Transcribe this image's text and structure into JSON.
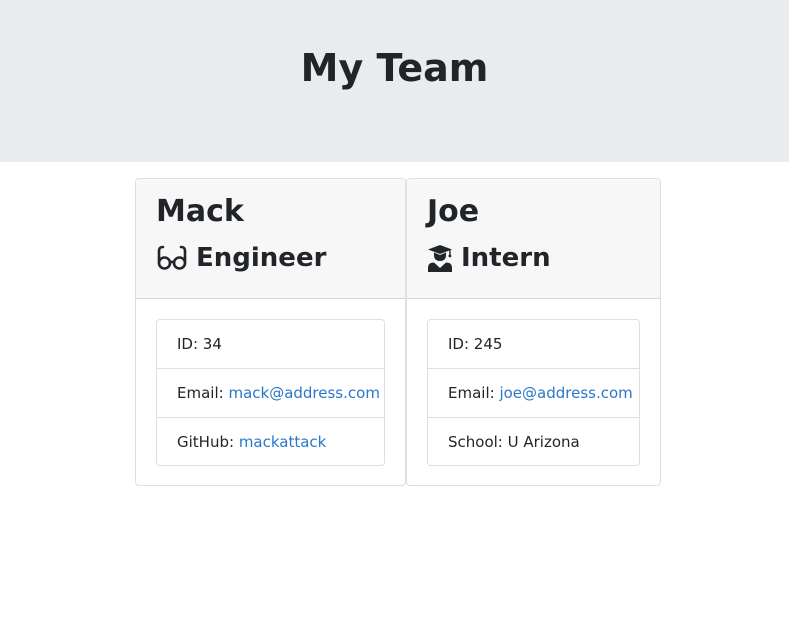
{
  "header": {
    "title": "My Team"
  },
  "cards": [
    {
      "name": "Mack",
      "role": "Engineer",
      "role_icon": "glasses-icon",
      "id_label": "ID: ",
      "id": "34",
      "email_label": "Email: ",
      "email": "mack@address.com",
      "extra_label": "GitHub: ",
      "extra_value": "mackattack"
    },
    {
      "name": "Joe",
      "role": "Intern",
      "role_icon": "graduate-icon",
      "id_label": "ID: ",
      "id": "245",
      "email_label": "Email: ",
      "email": "joe@address.com",
      "extra_label": "School: ",
      "extra_value": "U Arizona"
    }
  ],
  "colors": {
    "header_bg": "#e9ecef",
    "card_header_bg": "#f7f7f7",
    "link": "#2a77c9",
    "text": "#212529"
  }
}
